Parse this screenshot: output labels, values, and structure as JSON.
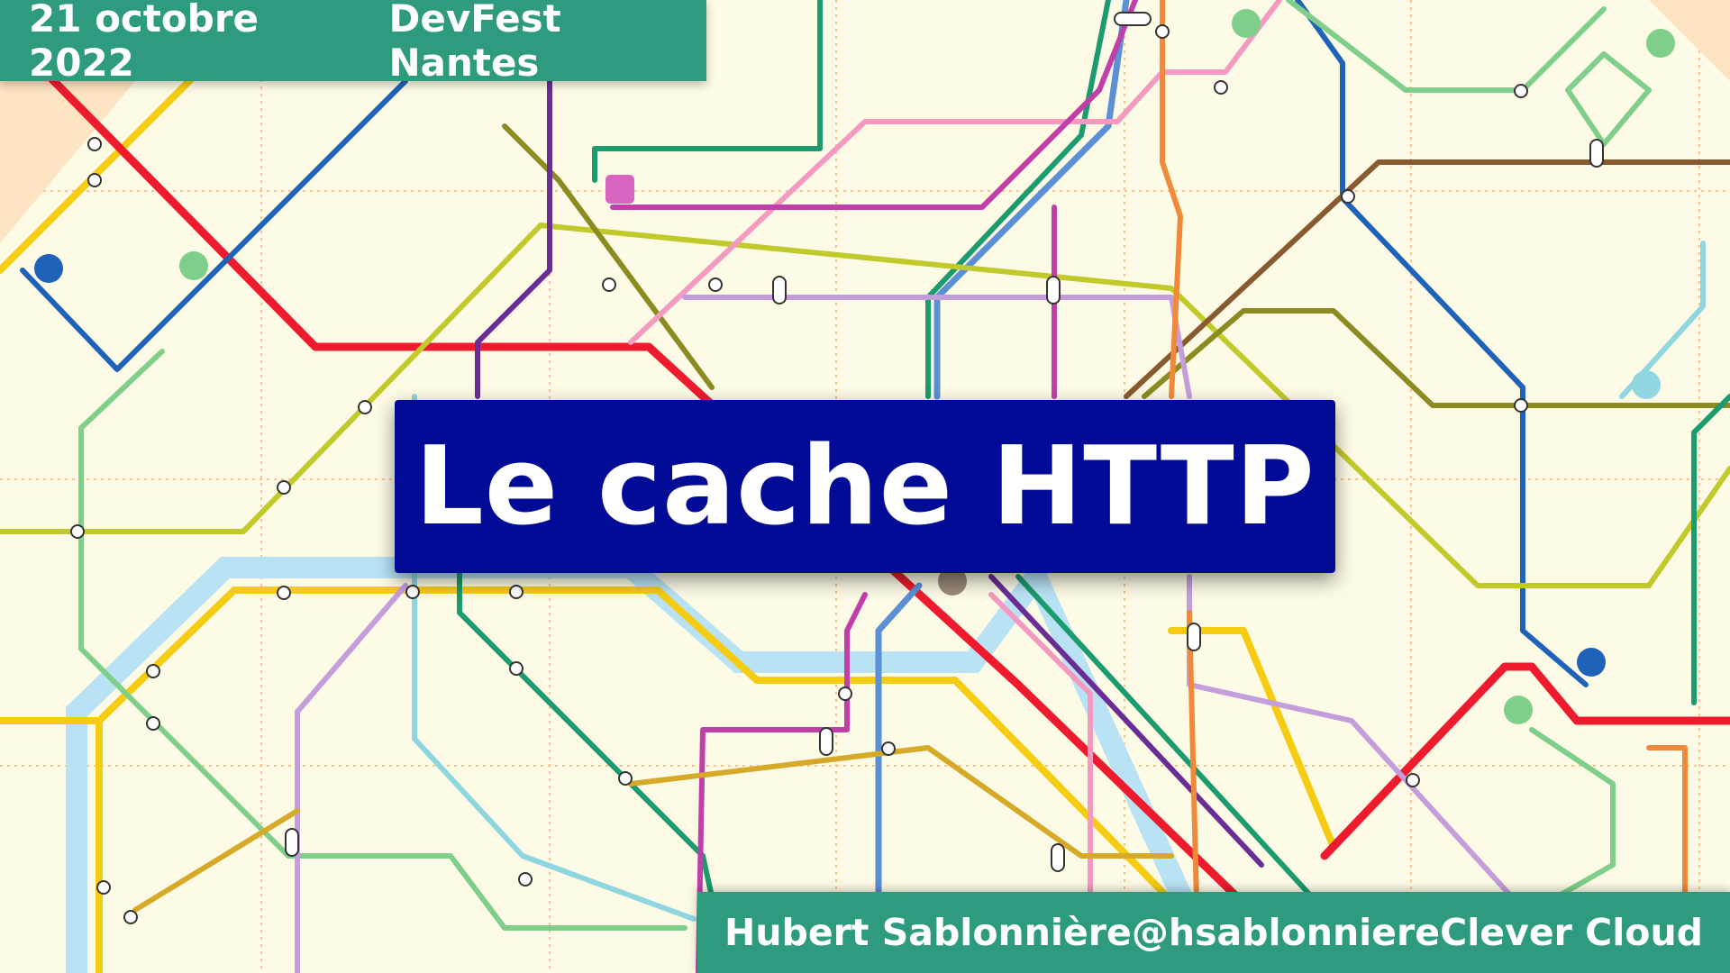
{
  "header": {
    "date": "21 octobre 2022",
    "event": "DevFest Nantes"
  },
  "slide": {
    "title": "Le cache HTTP"
  },
  "footer": {
    "speaker": "Hubert Sablonnière",
    "handle": "@hsablonniere",
    "company": "Clever Cloud"
  },
  "colors": {
    "background": "#fdfbe6",
    "banner": "#2e9a7e",
    "title_box": "#020b96",
    "river": "#b9e3f5",
    "grid": "#f0b27a"
  },
  "map_lines": [
    {
      "name": "red-line",
      "color": "#ee1b2e"
    },
    {
      "name": "yellow-line",
      "color": "#f6cc12"
    },
    {
      "name": "blue-line",
      "color": "#1f63b8"
    },
    {
      "name": "green-line",
      "color": "#1c9b6e"
    },
    {
      "name": "light-green-line",
      "color": "#7fcf8a"
    },
    {
      "name": "olive-line",
      "color": "#c2c92a"
    },
    {
      "name": "pink-line",
      "color": "#f49ac1"
    },
    {
      "name": "magenta-line",
      "color": "#c13fa8"
    },
    {
      "name": "purple-line",
      "color": "#6a2d96"
    },
    {
      "name": "lilac-line",
      "color": "#c49edb"
    },
    {
      "name": "orange-line",
      "color": "#f08a3a"
    },
    {
      "name": "brown-line",
      "color": "#8a5a2f"
    },
    {
      "name": "khaki-line",
      "color": "#8b8b22"
    },
    {
      "name": "gold-line",
      "color": "#d6a928"
    },
    {
      "name": "cyan-line",
      "color": "#8fd6e0"
    },
    {
      "name": "steel-blue-line",
      "color": "#5b8fd6"
    }
  ]
}
